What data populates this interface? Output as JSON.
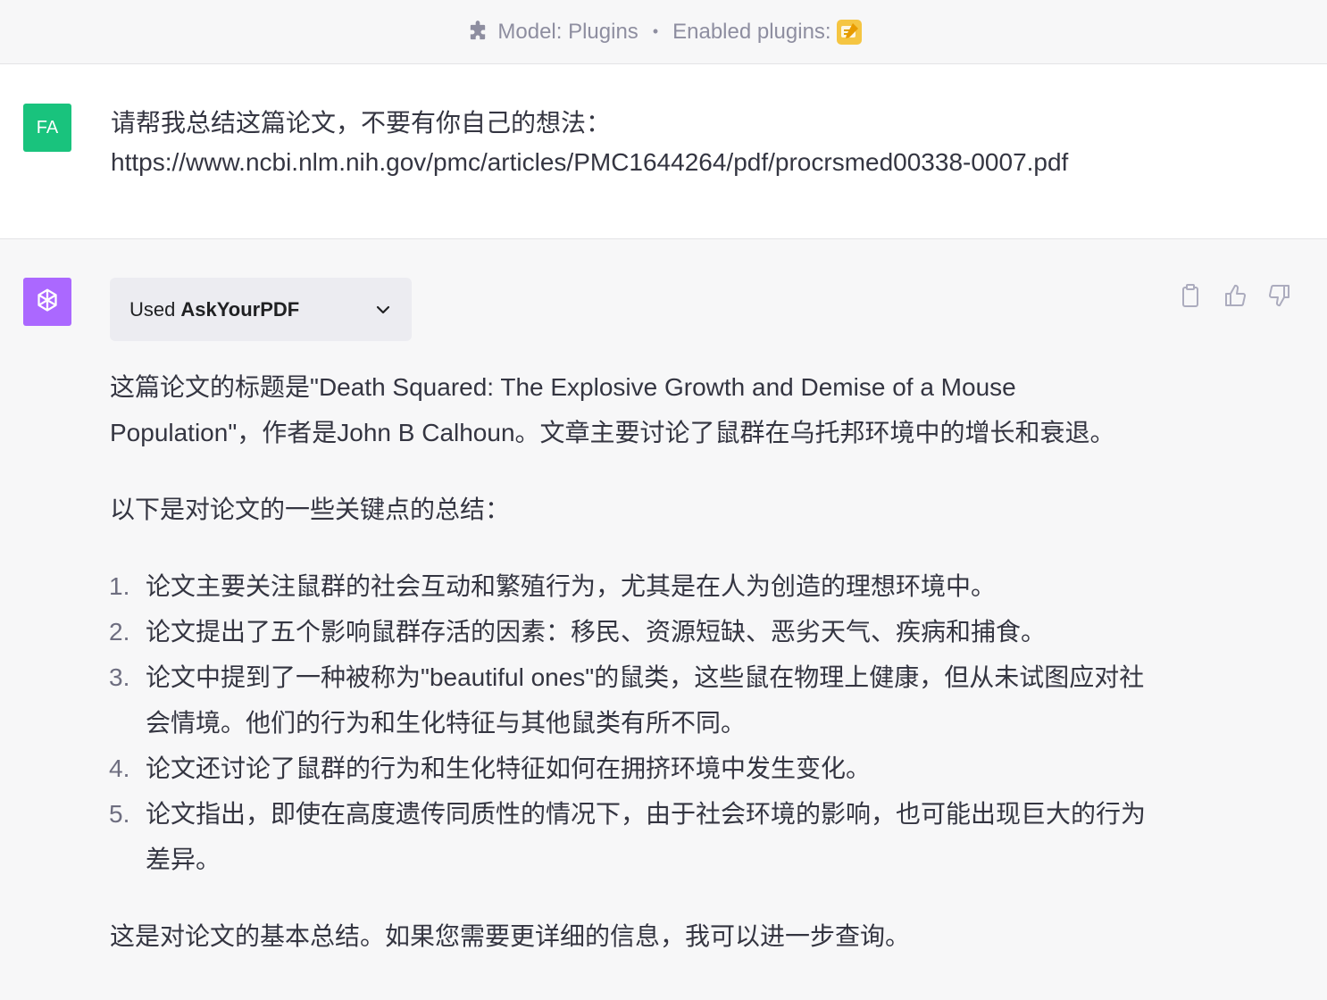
{
  "topbar": {
    "model_label": "Model: Plugins",
    "separator": "•",
    "plugins_label": "Enabled plugins:",
    "plugin_icon": "askyourpdf-logo"
  },
  "user_message": {
    "avatar_initials": "FA",
    "avatar_color": "#19c37d",
    "line1": "请帮我总结这篇论文，不要有你自己的想法：",
    "line2": "https://www.ncbi.nlm.nih.gov/pmc/articles/PMC1644264/pdf/procrsmed00338-0007.pdf"
  },
  "assistant_message": {
    "avatar_color": "#ab68ff",
    "avatar_icon": "openai-logo-icon",
    "plugin_used": {
      "prefix": "Used",
      "name": "AskYourPDF"
    },
    "actions": [
      "copy-icon",
      "thumbs-up-icon",
      "thumbs-down-icon"
    ],
    "paragraph1": "这篇论文的标题是\"Death Squared: The Explosive Growth and Demise of a Mouse Population\"，作者是John B Calhoun。文章主要讨论了鼠群在乌托邦环境中的增长和衰退。",
    "paragraph2": "以下是对论文的一些关键点的总结：",
    "list": [
      {
        "num": "1.",
        "text": "论文主要关注鼠群的社会互动和繁殖行为，尤其是在人为创造的理想环境中。"
      },
      {
        "num": "2.",
        "text": "论文提出了五个影响鼠群存活的因素：移民、资源短缺、恶劣天气、疾病和捕食。"
      },
      {
        "num": "3.",
        "text": "论文中提到了一种被称为\"beautiful ones\"的鼠类，这些鼠在物理上健康，但从未试图应对社会情境。他们的行为和生化特征与其他鼠类有所不同。"
      },
      {
        "num": "4.",
        "text": "论文还讨论了鼠群的行为和生化特征如何在拥挤环境中发生变化。"
      },
      {
        "num": "5.",
        "text": "论文指出，即使在高度遗传同质性的情况下，由于社会环境的影响，也可能出现巨大的行为差异。"
      }
    ],
    "paragraph3": "这是对论文的基本总结。如果您需要更详细的信息，我可以进一步查询。"
  }
}
